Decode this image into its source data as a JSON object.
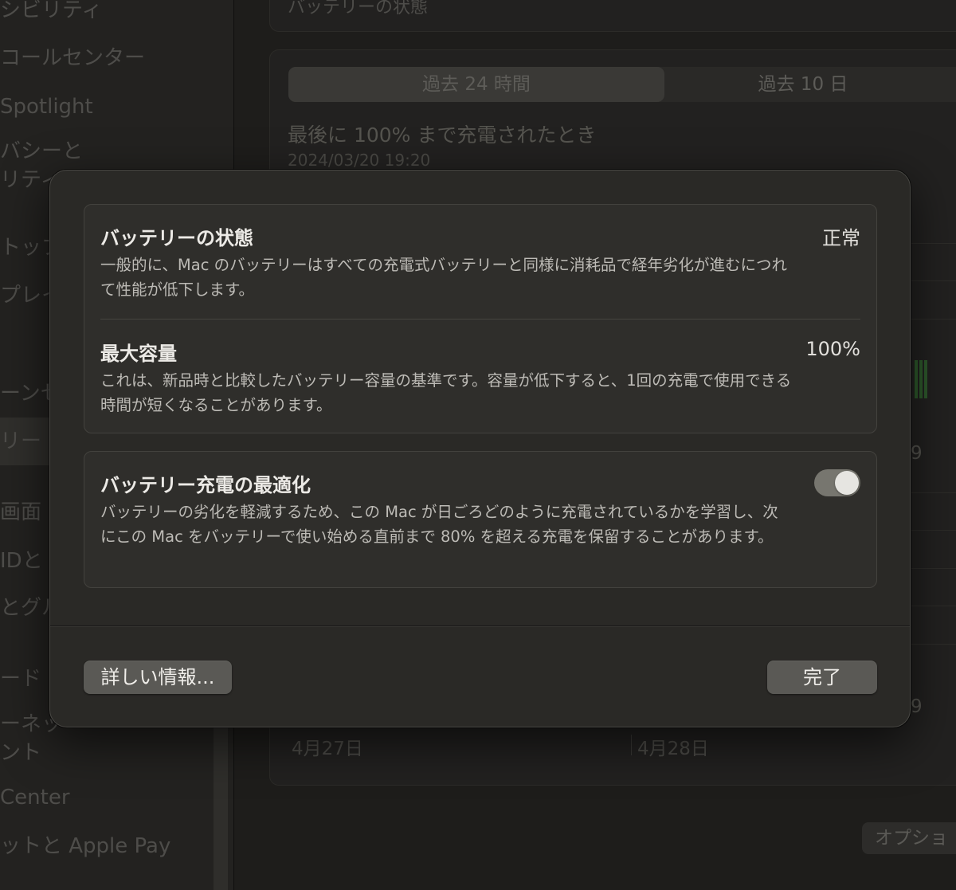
{
  "background": {
    "sidebar": {
      "items": [
        "シビリティ",
        "コールセンター",
        "Spotlight",
        "バシーと",
        "リティ",
        "トップ",
        "プレイ",
        "ーンセ",
        "リー",
        "画面",
        "IDと",
        "とグル",
        "ード",
        "ーネッ",
        "ント",
        "Center",
        "ットと Apple Pay"
      ]
    },
    "top_card_title": "バッテリーの状態",
    "segmented_control": {
      "options": [
        "過去 24 時間",
        "過去 10 日"
      ],
      "selected": "過去 24 時間"
    },
    "last_full_charge": {
      "label": "最後に 100% まで充電されたとき",
      "timestamp": "2024/03/20 19:20"
    },
    "chart_right_ticks": [
      "9",
      "9"
    ],
    "dates": [
      "4月27日",
      "4月28日"
    ],
    "options_button": "オプショ"
  },
  "sheet": {
    "battery_condition": {
      "title": "バッテリーの状態",
      "value": "正常",
      "description": "一般的に、Mac のバッテリーはすべての充電式バッテリーと同様に消耗品で経年劣化が進むにつれて性能が低下します。"
    },
    "maximum_capacity": {
      "title": "最大容量",
      "value": "100%",
      "description": "これは、新品時と比較したバッテリー容量の基準です。容量が低下すると、1回の充電で使用できる時間が短くなることがあります。"
    },
    "optimized_charging": {
      "title": "バッテリー充電の最適化",
      "enabled": true,
      "description": "バッテリーの劣化を軽減するため、この Mac が日ごろどのように充電されているかを学習し、次にこの Mac をバッテリーで使い始める直前まで 80% を超える充電を保留することがあります。"
    },
    "buttons": {
      "more_info": "詳しい情報...",
      "done": "完了"
    }
  }
}
